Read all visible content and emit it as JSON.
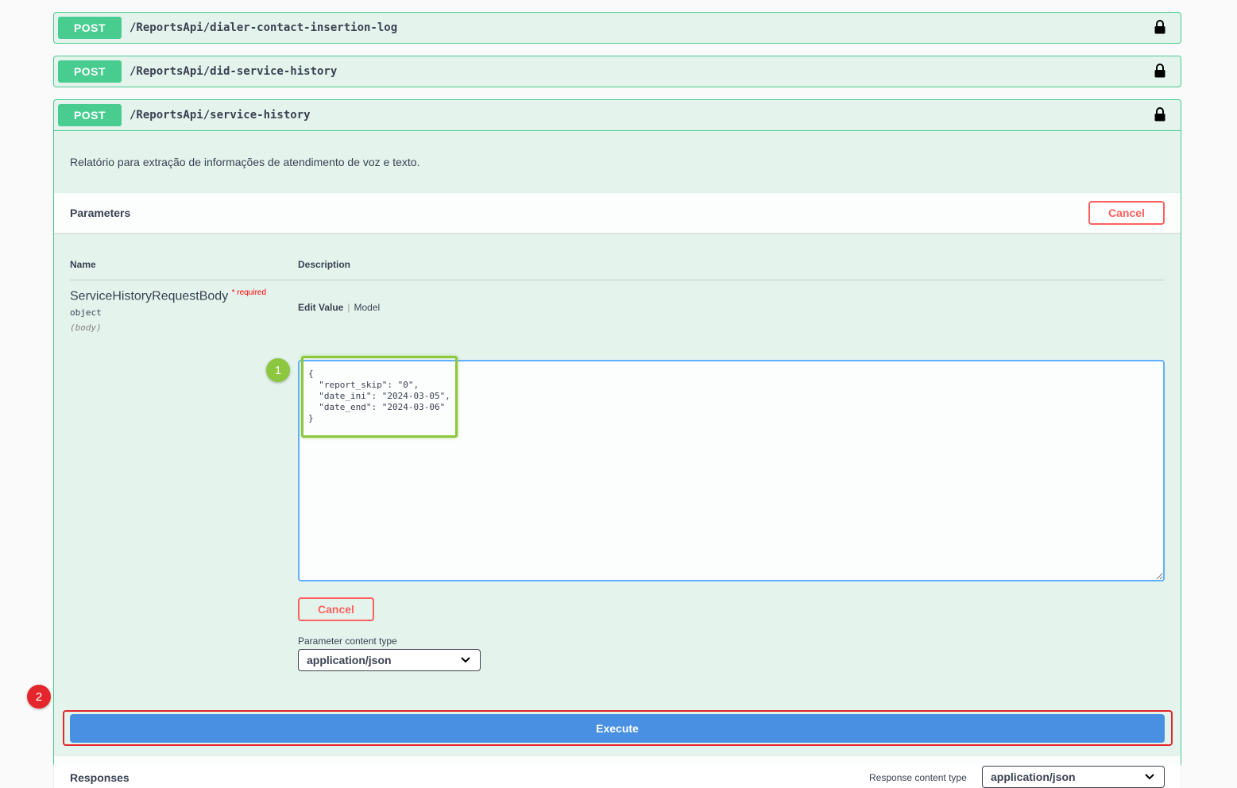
{
  "endpoints": [
    {
      "method": "POST",
      "path": "/ReportsApi/dialer-contact-insertion-log"
    },
    {
      "method": "POST",
      "path": "/ReportsApi/did-service-history"
    },
    {
      "method": "POST",
      "path": "/ReportsApi/service-history"
    }
  ],
  "expanded": {
    "description": "Relatório para extração de informações de atendimento de voz e texto.",
    "parameters_title": "Parameters",
    "cancel_label": "Cancel",
    "col_name": "Name",
    "col_description": "Description",
    "param": {
      "name": "ServiceHistoryRequestBody",
      "required_mark": "* required",
      "type": "object",
      "in": "(body)"
    },
    "tab_edit_value": "Edit Value",
    "tab_model": "Model",
    "body_value": "{\n  \"report_skip\": \"0\",\n  \"date_ini\": \"2024-03-05\",\n  \"date_end\": \"2024-03-06\"\n}",
    "cancel_label_2": "Cancel",
    "content_type_label": "Parameter content type",
    "content_type_value": "application/json",
    "execute_label": "Execute",
    "responses_title": "Responses",
    "response_content_type_label": "Response content type",
    "response_content_type_value": "application/json"
  },
  "callouts": [
    "1",
    "2"
  ],
  "colors": {
    "post": "#49cc90",
    "execute": "#4990e2",
    "cancel": "#ff6060",
    "callout_green": "#8dc63f",
    "callout_red": "#e3262b"
  },
  "icons": [
    "lock-icon",
    "chevron-down-icon"
  ]
}
